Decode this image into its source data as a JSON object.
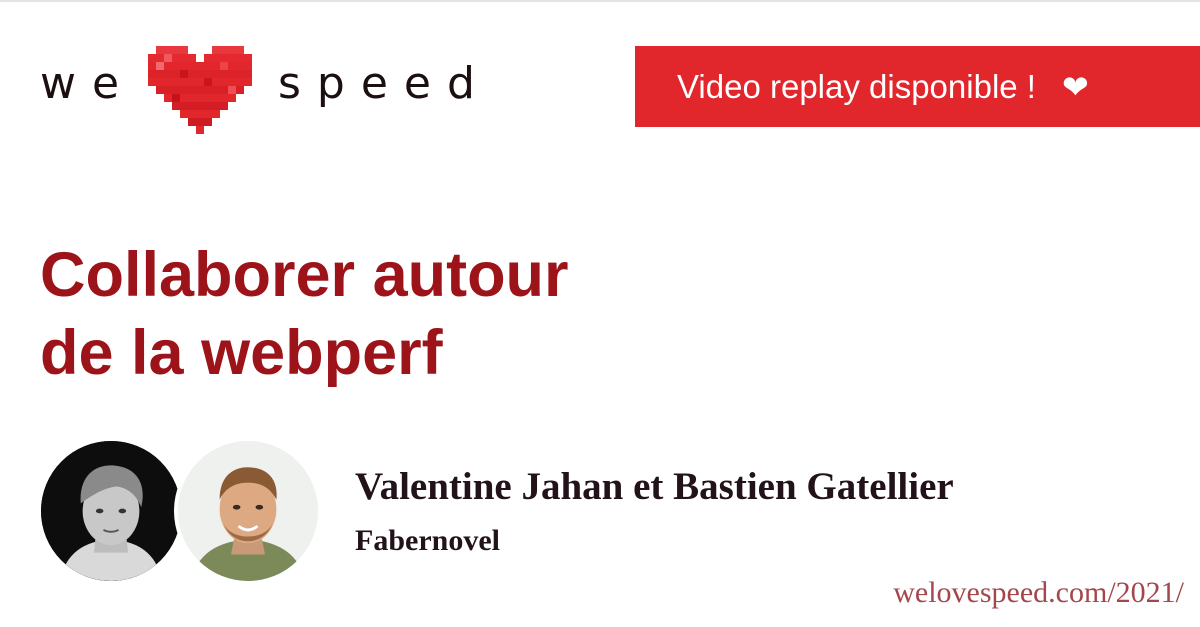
{
  "logo": {
    "word_left": "we",
    "word_right": "speed",
    "heart_icon": "pixel-heart-icon",
    "heart_color": "#e1262c"
  },
  "banner": {
    "label": "Video replay disponible !",
    "icon": "heart-icon",
    "icon_glyph": "❤",
    "background": "#e1262c"
  },
  "talk": {
    "title_line_1": "Collaborer autour",
    "title_line_2": "de la webperf",
    "title_color": "#9c1319"
  },
  "speakers": {
    "names": "Valentine Jahan et Bastien Gatellier",
    "company": "Fabernovel"
  },
  "footer": {
    "url": "welovespeed.com/2021/",
    "url_color": "#a4474d"
  }
}
